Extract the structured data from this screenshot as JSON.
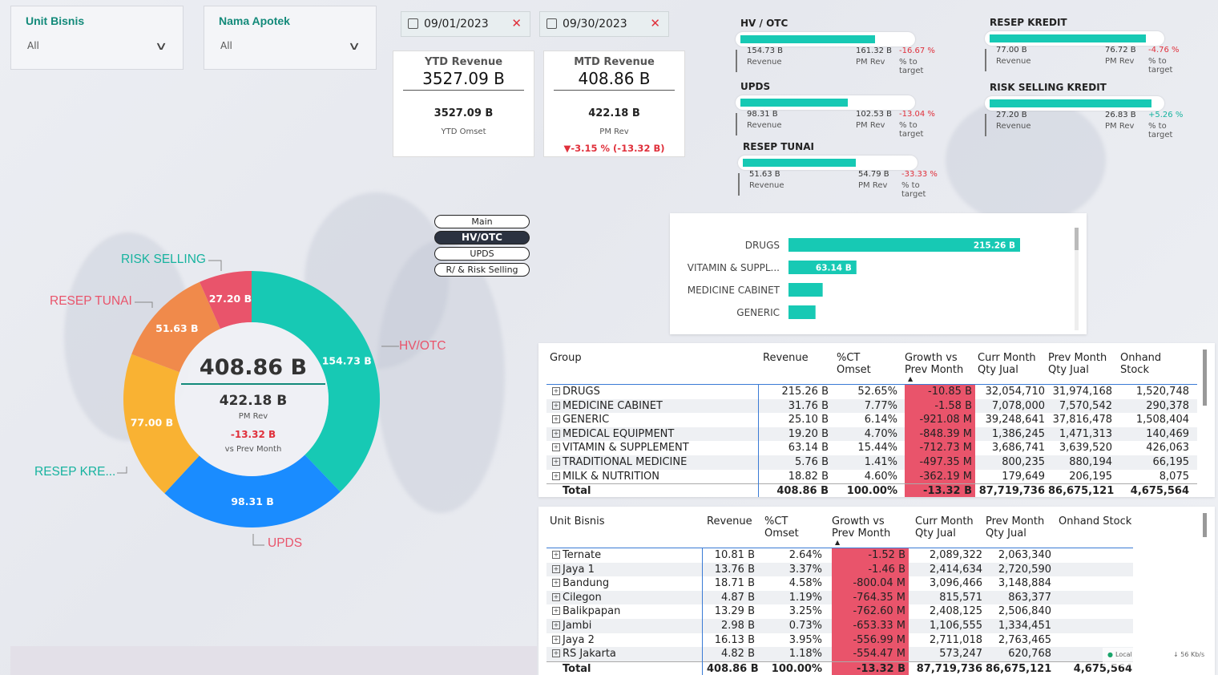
{
  "slicers": {
    "unit_bisnis": {
      "title": "Unit Bisnis",
      "value": "All"
    },
    "nama_apotek": {
      "title": "Nama Apotek",
      "value": "All"
    }
  },
  "dates": {
    "start": "09/01/2023",
    "end": "09/30/2023"
  },
  "kpi": {
    "ytd": {
      "title": "YTD Revenue",
      "value": "3527.09 B",
      "sub_value": "3527.09 B",
      "sub_label": "YTD Omset"
    },
    "mtd": {
      "title": "MTD Revenue",
      "value": "408.86 B",
      "sub_value": "422.18 B",
      "sub_label": "PM Rev",
      "delta": "▼-3.15 % (-13.32 B)"
    }
  },
  "minis": [
    {
      "title": "HV / OTC",
      "fill": 0.8,
      "rev": "154.73 B",
      "rev_label": "Revenue",
      "pm": "161.32 B",
      "pm_label": "PM Rev",
      "pct": "-16.67 %",
      "pct_label": "% to target",
      "pct_color": "#e0303b"
    },
    {
      "title": "UPDS",
      "fill": 0.64,
      "rev": "98.31 B",
      "rev_label": "Revenue",
      "pm": "102.53 B",
      "pm_label": "PM Rev",
      "pct": "-13.04 %",
      "pct_label": "% to target",
      "pct_color": "#e0303b"
    },
    {
      "title": "RESEP TUNAI",
      "fill": 0.67,
      "rev": "51.63 B",
      "rev_label": "Revenue",
      "pm": "54.79 B",
      "pm_label": "PM Rev",
      "pct": "-33.33 %",
      "pct_label": "% to target",
      "pct_color": "#e0303b"
    },
    {
      "title": "RESEP KREDIT",
      "fill": 0.93,
      "rev": "77.00 B",
      "rev_label": "Revenue",
      "pm": "76.72 B",
      "pm_label": "PM Rev",
      "pct": "-4.76 %",
      "pct_label": "% to target",
      "pct_color": "#e0303b"
    },
    {
      "title": "RISK SELLING KREDIT",
      "fill": 0.96,
      "rev": "27.20 B",
      "rev_label": "Revenue",
      "pm": "26.83 B",
      "pm_label": "PM Rev",
      "pct": "+5.26 %",
      "pct_label": "% to target",
      "pct_color": "#17b39f"
    }
  ],
  "toggles": [
    {
      "label": "Main",
      "active": false
    },
    {
      "label": "HV/OTC",
      "active": true
    },
    {
      "label": "UPDS",
      "active": false
    },
    {
      "label": "R/ & Risk Selling",
      "active": false
    }
  ],
  "bars": {
    "items": [
      {
        "label": "DRUGS",
        "value": 215.26,
        "text": "215.26 B"
      },
      {
        "label": "VITAMIN & SUPPL...",
        "value": 63.14,
        "text": "63.14 B"
      },
      {
        "label": "MEDICINE CABINET",
        "value": 31.76,
        "text": ""
      },
      {
        "label": "GENERIC",
        "value": 25.1,
        "text": ""
      }
    ],
    "color": "#17c9b4"
  },
  "donut": {
    "center_value": "408.86 B",
    "pm_value": "422.18 B",
    "pm_label": "PM Rev",
    "diff_value": "-13.32 B",
    "diff_label": "vs Prev Month",
    "slices": [
      {
        "name": "HV/OTC",
        "value": 154.73,
        "text": "154.73 B",
        "color": "#17c9b4",
        "label_color": "#e9546b"
      },
      {
        "name": "UPDS",
        "value": 98.31,
        "text": "98.31 B",
        "color": "#1a8cff",
        "label_color": "#e9546b"
      },
      {
        "name": "RESEP KRE...",
        "value": 77.0,
        "text": "77.00 B",
        "color": "#f9b233",
        "label_color": "#17b39f"
      },
      {
        "name": "RESEP TUNAI",
        "value": 51.63,
        "text": "51.63 B",
        "color": "#f08a4b",
        "label_color": "#e9546b"
      },
      {
        "name": "RISK SELLING",
        "value": 27.2,
        "text": "27.20 B",
        "color": "#e9546b",
        "label_color": "#17b39f"
      }
    ]
  },
  "table_group": {
    "headers": [
      "Group",
      "Revenue",
      "%CT Omset",
      "Growth vs Prev Month",
      "Curr Month Qty Jual",
      "Prev Month Qty Jual",
      "Onhand Stock"
    ],
    "rows": [
      [
        "DRUGS",
        "215.26 B",
        "52.65%",
        "-10.85 B",
        "32,054,710",
        "31,974,168",
        "1,520,748"
      ],
      [
        "MEDICINE CABINET",
        "31.76 B",
        "7.77%",
        "-1.58 B",
        "7,078,000",
        "7,570,542",
        "290,378"
      ],
      [
        "GENERIC",
        "25.10 B",
        "6.14%",
        "-921.08 M",
        "39,248,641",
        "37,816,478",
        "1,508,404"
      ],
      [
        "MEDICAL EQUIPMENT",
        "19.20 B",
        "4.70%",
        "-848.39 M",
        "1,386,245",
        "1,471,313",
        "140,469"
      ],
      [
        "VITAMIN & SUPPLEMENT",
        "63.14 B",
        "15.44%",
        "-712.73 M",
        "3,686,741",
        "3,639,520",
        "426,063"
      ],
      [
        "TRADITIONAL MEDICINE",
        "5.76 B",
        "1.41%",
        "-497.35 M",
        "800,235",
        "880,194",
        "66,195"
      ],
      [
        "MILK & NUTRITION",
        "18.82 B",
        "4.60%",
        "-362.19 M",
        "179,649",
        "206,195",
        "8,075"
      ]
    ],
    "total": [
      "Total",
      "408.86 B",
      "100.00%",
      "-13.32 B",
      "87,719,736",
      "86,675,121",
      "4,675,564"
    ]
  },
  "table_unit": {
    "headers": [
      "Unit Bisnis",
      "Revenue",
      "%CT Omset",
      "Growth vs Prev Month",
      "Curr Month Qty Jual",
      "Prev Month Qty Jual",
      "Onhand Stock"
    ],
    "rows": [
      [
        "Ternate",
        "10.81 B",
        "2.64%",
        "-1.52 B",
        "2,089,322",
        "2,063,340",
        ""
      ],
      [
        "Jaya 1",
        "13.76 B",
        "3.37%",
        "-1.46 B",
        "2,414,634",
        "2,720,590",
        ""
      ],
      [
        "Bandung",
        "18.71 B",
        "4.58%",
        "-800.04 M",
        "3,096,466",
        "3,148,884",
        ""
      ],
      [
        "Cilegon",
        "4.87 B",
        "1.19%",
        "-764.35 M",
        "815,571",
        "863,377",
        ""
      ],
      [
        "Balikpapan",
        "13.29 B",
        "3.25%",
        "-762.60 M",
        "2,408,125",
        "2,506,840",
        ""
      ],
      [
        "Jambi",
        "2.98 B",
        "0.73%",
        "-653.33 M",
        "1,106,555",
        "1,334,451",
        ""
      ],
      [
        "Jaya 2",
        "16.13 B",
        "3.95%",
        "-556.99 M",
        "2,711,018",
        "2,763,465",
        ""
      ],
      [
        "RS Jakarta",
        "4.82 B",
        "1.18%",
        "-554.47 M",
        "573,247",
        "620,768",
        ""
      ]
    ],
    "total": [
      "Total",
      "408.86 B",
      "100.00%",
      "-13.32 B",
      "87,719,736",
      "86,675,121",
      "4,675,564"
    ]
  },
  "netwidget": {
    "label": "Local",
    "speed": "↓ 56 Kb/s"
  }
}
